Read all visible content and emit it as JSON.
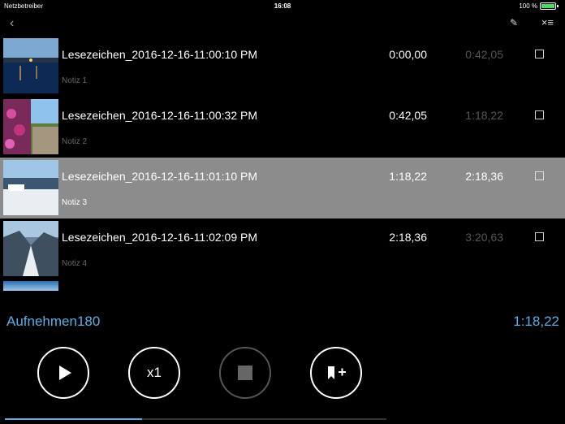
{
  "status_bar": {
    "carrier": "Netzbetreiber",
    "time": "16:08",
    "battery": "100 %"
  },
  "nav": {
    "back_icon": "chevron-left-icon",
    "edit_icon": "pen-icon",
    "list_icon": "close-list-icon"
  },
  "bookmarks": [
    {
      "title": "Lesezeichen_2016-12-16-11:00:10 PM",
      "note": "Notiz 1",
      "start": "0:00,00",
      "end": "0:42,05",
      "selected": false
    },
    {
      "title": "Lesezeichen_2016-12-16-11:00:32 PM",
      "note": "Notiz 2",
      "start": "0:42,05",
      "end": "1:18,22",
      "selected": false
    },
    {
      "title": "Lesezeichen_2016-12-16-11:01:10 PM",
      "note": "Notiz 3",
      "start": "1:18,22",
      "end": "2:18,36",
      "selected": true
    },
    {
      "title": "Lesezeichen_2016-12-16-11:02:09 PM",
      "note": "Notiz 4",
      "start": "2:18,36",
      "end": "3:20,63",
      "selected": false
    }
  ],
  "recording": {
    "name": "Aufnehmen180",
    "position": "1:18,22"
  },
  "controls": {
    "speed_label": "x1"
  },
  "playback_progress": 0.36,
  "colors": {
    "accent": "#5aaee6",
    "selected_row": "#8c8c8c",
    "background": "#000000"
  }
}
